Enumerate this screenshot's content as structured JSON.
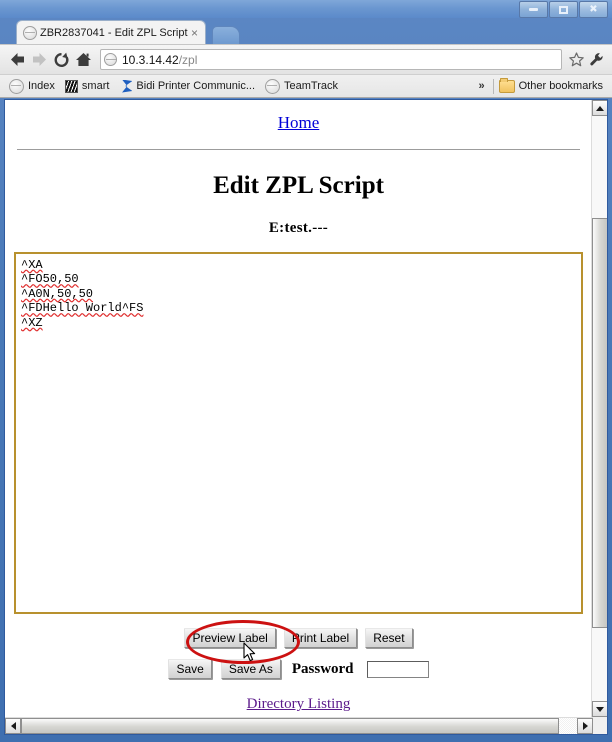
{
  "window": {
    "controls": {
      "minimize": "minimize",
      "maximize": "maximize",
      "close": "close"
    }
  },
  "browser": {
    "tab": {
      "title": "ZBR2837041 - Edit ZPL Script",
      "close_label": "×"
    },
    "omnibox": {
      "url_host": "10.3.14.42",
      "url_path": "/zpl"
    },
    "bookmarks": [
      {
        "label": "Index",
        "icon": "globe-icon"
      },
      {
        "label": "smart",
        "icon": "zebra-icon"
      },
      {
        "label": "Bidi Printer Communic...",
        "icon": "bidi-icon"
      },
      {
        "label": "TeamTrack",
        "icon": "globe-icon"
      }
    ],
    "overflow_label": "»",
    "other_bookmarks": "Other bookmarks"
  },
  "page": {
    "home_link": "Home",
    "title": "Edit ZPL Script",
    "subtitle": "E:test.---",
    "script_lines": [
      "^XA",
      "^FO50,50",
      "^A0N,50,50",
      "^FDHello World^FS",
      "^XZ"
    ],
    "buttons_row1": [
      {
        "label": "Preview Label",
        "name": "preview-label-button"
      },
      {
        "label": "Print Label",
        "name": "print-label-button"
      },
      {
        "label": "Reset",
        "name": "reset-button"
      }
    ],
    "buttons_row2": [
      {
        "label": "Save",
        "name": "save-button"
      },
      {
        "label": "Save As",
        "name": "save-as-button"
      }
    ],
    "password_label": "Password",
    "password_value": "",
    "password_placeholder": "",
    "directory_link": "Directory Listing"
  },
  "annotation": {
    "highlight_target": "Preview Label",
    "ellipse_color": "#cc1111"
  }
}
